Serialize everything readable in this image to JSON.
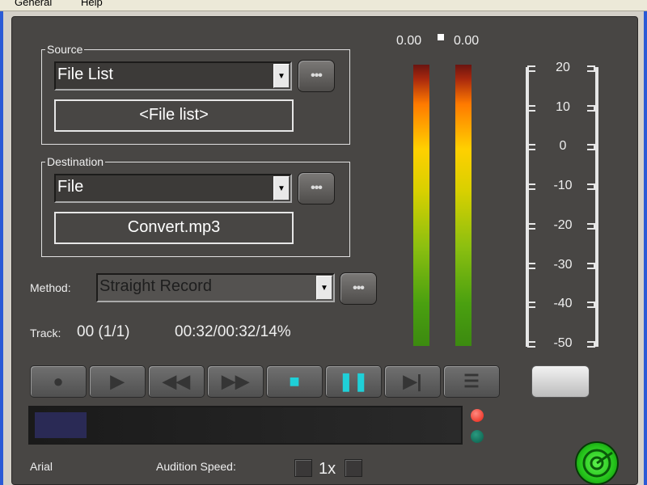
{
  "menu": {
    "items": [
      "General",
      "Help"
    ]
  },
  "source": {
    "title": "Source",
    "selected": "File List",
    "value_box": "<File list>",
    "more_label": "•••"
  },
  "destination": {
    "title": "Destination",
    "selected": "File",
    "value_box": "Convert.mp3",
    "more_label": "•••"
  },
  "method": {
    "label": "Method:",
    "selected": "Straight Record",
    "more_label": "•••"
  },
  "track": {
    "label": "Track:",
    "value": "00 (1/1)",
    "time": "00:32/00:32/14%"
  },
  "meters": {
    "left_value": "0.00",
    "right_value": "0.00",
    "scale": [
      "20",
      "10",
      "0",
      "-10",
      "-20",
      "-30",
      "-40",
      "-50"
    ]
  },
  "transport": {
    "buttons": [
      {
        "name": "record-button",
        "glyph": "●"
      },
      {
        "name": "play-button",
        "glyph": "▶"
      },
      {
        "name": "rewind-button",
        "glyph": "◀◀"
      },
      {
        "name": "fast-forward-button",
        "glyph": "▶▶"
      },
      {
        "name": "stop-button",
        "glyph": "■"
      },
      {
        "name": "pause-button",
        "glyph": "❚❚"
      },
      {
        "name": "skip-button",
        "glyph": "▶|"
      },
      {
        "name": "list-button",
        "glyph": "☰"
      }
    ]
  },
  "progress": {
    "fraction": 0.12
  },
  "footer": {
    "font_label": "Arial",
    "audition_label": "Audition Speed:",
    "speed_value": "1x"
  },
  "colors": {
    "led_red": "#e81e10",
    "led_dark": "#0a5a48",
    "accent_cyan": "#1fd0d8"
  }
}
